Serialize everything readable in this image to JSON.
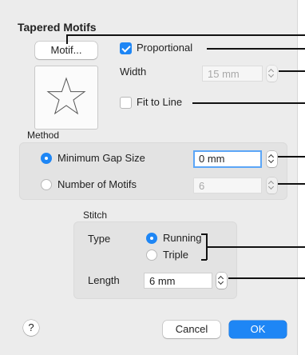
{
  "dialog": {
    "title": "Tapered Motifs",
    "motif_button": "Motif...",
    "preview_icon": "star-outline-icon",
    "proportional": {
      "label": "Proportional",
      "checked": true
    },
    "width": {
      "label": "Width",
      "value": "15 mm",
      "enabled": false
    },
    "fit_to_line": {
      "label": "Fit to Line",
      "checked": false
    }
  },
  "method": {
    "heading": "Method",
    "options": [
      {
        "label": "Minimum Gap Size",
        "selected": true,
        "value": "0 mm",
        "enabled": true
      },
      {
        "label": "Number of Motifs",
        "selected": false,
        "value": "6",
        "enabled": false
      }
    ]
  },
  "stitch": {
    "heading": "Stitch",
    "type_label": "Type",
    "types": [
      {
        "label": "Running",
        "selected": true
      },
      {
        "label": "Triple",
        "selected": false
      }
    ],
    "length_label": "Length",
    "length_value": "6 mm"
  },
  "footer": {
    "help": "?",
    "cancel": "Cancel",
    "ok": "OK"
  },
  "colors": {
    "accent": "#1e86f5",
    "window_bg": "#ececec",
    "group_bg": "#e3e3e3"
  }
}
